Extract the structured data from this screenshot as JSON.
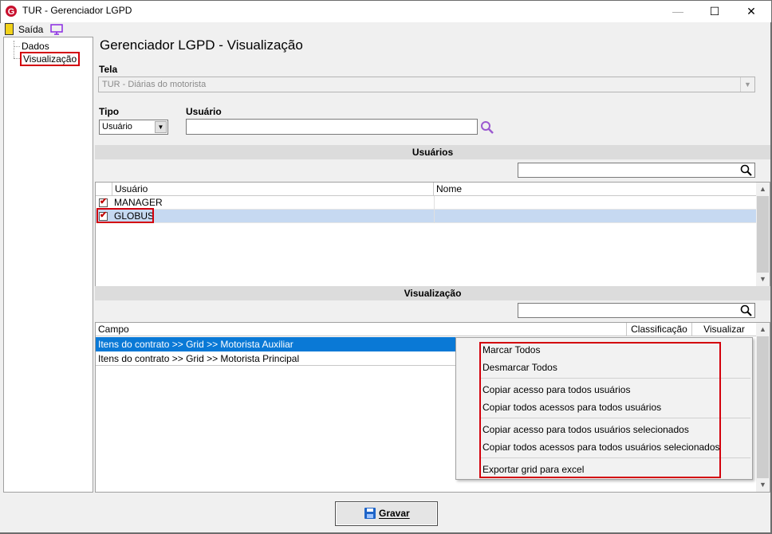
{
  "window": {
    "title": "TUR - Gerenciador LGPD",
    "minimize": "—",
    "maximize": "☐",
    "close": "✕"
  },
  "toolbar": {
    "exit_label": "Saída"
  },
  "tree": {
    "items": [
      {
        "label": "Dados"
      },
      {
        "label": "Visualização"
      }
    ]
  },
  "main": {
    "title": "Gerenciador LGPD - Visualização",
    "tela": {
      "label": "Tela",
      "value": "TUR - Diárias do motorista"
    },
    "tipo": {
      "label": "Tipo",
      "value": "Usuário"
    },
    "usuario": {
      "label": "Usuário",
      "value": ""
    }
  },
  "usuarios_section": {
    "header": "Usuários",
    "columns": [
      "Usuário",
      "Nome"
    ],
    "rows": [
      {
        "checked": true,
        "usuario": "MANAGER",
        "nome": ""
      },
      {
        "checked": true,
        "usuario": "GLOBUS",
        "nome": ""
      }
    ]
  },
  "visualizacao_section": {
    "header": "Visualização",
    "columns": [
      "Campo",
      "Classificação",
      "Visualizar"
    ],
    "rows": [
      {
        "campo": "Itens do contrato >> Grid >> Motorista Auxiliar"
      },
      {
        "campo": "Itens do contrato >> Grid >> Motorista Principal"
      }
    ]
  },
  "context_menu": {
    "items": [
      "Marcar Todos",
      "Desmarcar Todos",
      "Copiar acesso para todos usuários",
      "Copiar todos acessos para todos usuários",
      "Copiar acesso para todos usuários selecionados",
      "Copiar todos acessos para todos usuários selecionados",
      "Exportar grid para excel"
    ]
  },
  "footer": {
    "save_label": "Gravar"
  },
  "colors": {
    "highlight_red": "#d3000b",
    "selection_blue": "#0a79d6",
    "selected_row": "#c6d9f1",
    "search_icon": "#9b59d0"
  }
}
